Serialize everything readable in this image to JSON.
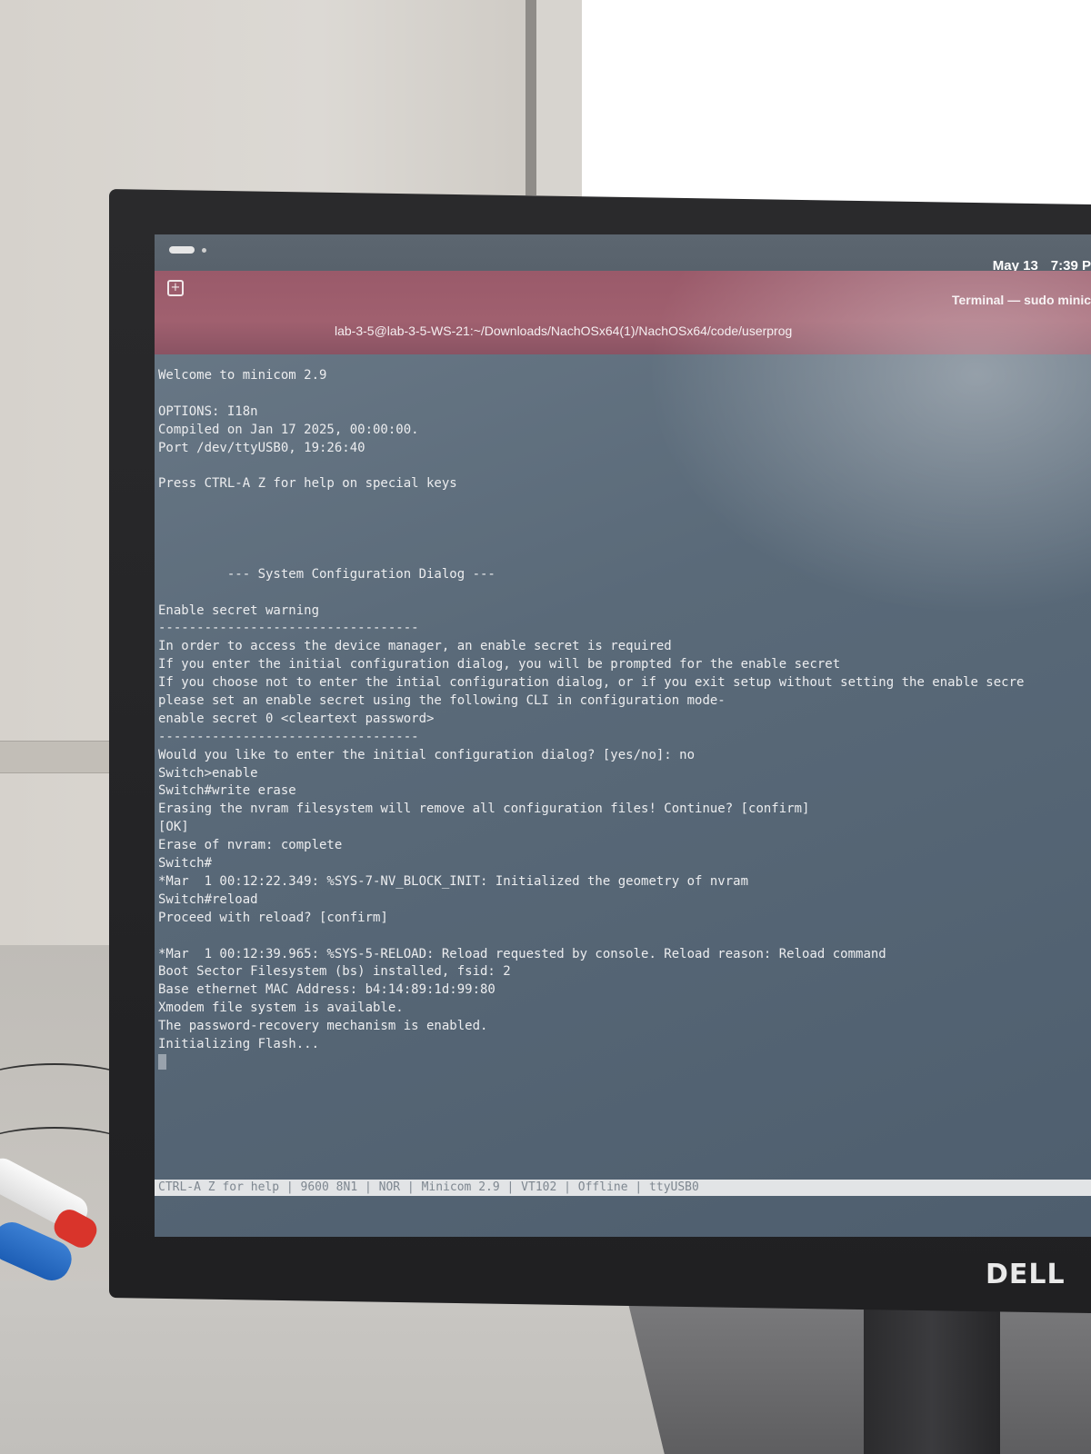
{
  "menubar": {
    "date": "May 13",
    "time": "7:39 P"
  },
  "window": {
    "title": "Terminal — sudo minic",
    "path": "lab-3-5@lab-3-5-WS-21:~/Downloads/NachOSx64(1)/NachOSx64/code/userprog",
    "new_tab_icon": "plus-square-icon"
  },
  "terminal": {
    "lines": [
      "Welcome to minicom 2.9",
      "",
      "OPTIONS: I18n",
      "Compiled on Jan 17 2025, 00:00:00.",
      "Port /dev/ttyUSB0, 19:26:40",
      "",
      "Press CTRL-A Z for help on special keys",
      "",
      "",
      "",
      "",
      "         --- System Configuration Dialog ---",
      "",
      "Enable secret warning",
      "----------------------------------",
      "In order to access the device manager, an enable secret is required",
      "If you enter the initial configuration dialog, you will be prompted for the enable secret",
      "If you choose not to enter the intial configuration dialog, or if you exit setup without setting the enable secre",
      "please set an enable secret using the following CLI in configuration mode-",
      "enable secret 0 <cleartext password>",
      "----------------------------------",
      "Would you like to enter the initial configuration dialog? [yes/no]: no",
      "Switch>enable",
      "Switch#write erase",
      "Erasing the nvram filesystem will remove all configuration files! Continue? [confirm]",
      "[OK]",
      "Erase of nvram: complete",
      "Switch#",
      "*Mar  1 00:12:22.349: %SYS-7-NV_BLOCK_INIT: Initialized the geometry of nvram",
      "Switch#reload",
      "Proceed with reload? [confirm]",
      "",
      "*Mar  1 00:12:39.965: %SYS-5-RELOAD: Reload requested by console. Reload reason: Reload command",
      "Boot Sector Filesystem (bs) installed, fsid: 2",
      "Base ethernet MAC Address: b4:14:89:1d:99:80",
      "Xmodem file system is available.",
      "The password-recovery mechanism is enabled.",
      "Initializing Flash..."
    ]
  },
  "statusbar": {
    "text": "CTRL-A Z for help | 9600 8N1 | NOR | Minicom 2.9 | VT102 | Offline | ttyUSB0"
  },
  "monitor": {
    "brand": "DELL"
  }
}
